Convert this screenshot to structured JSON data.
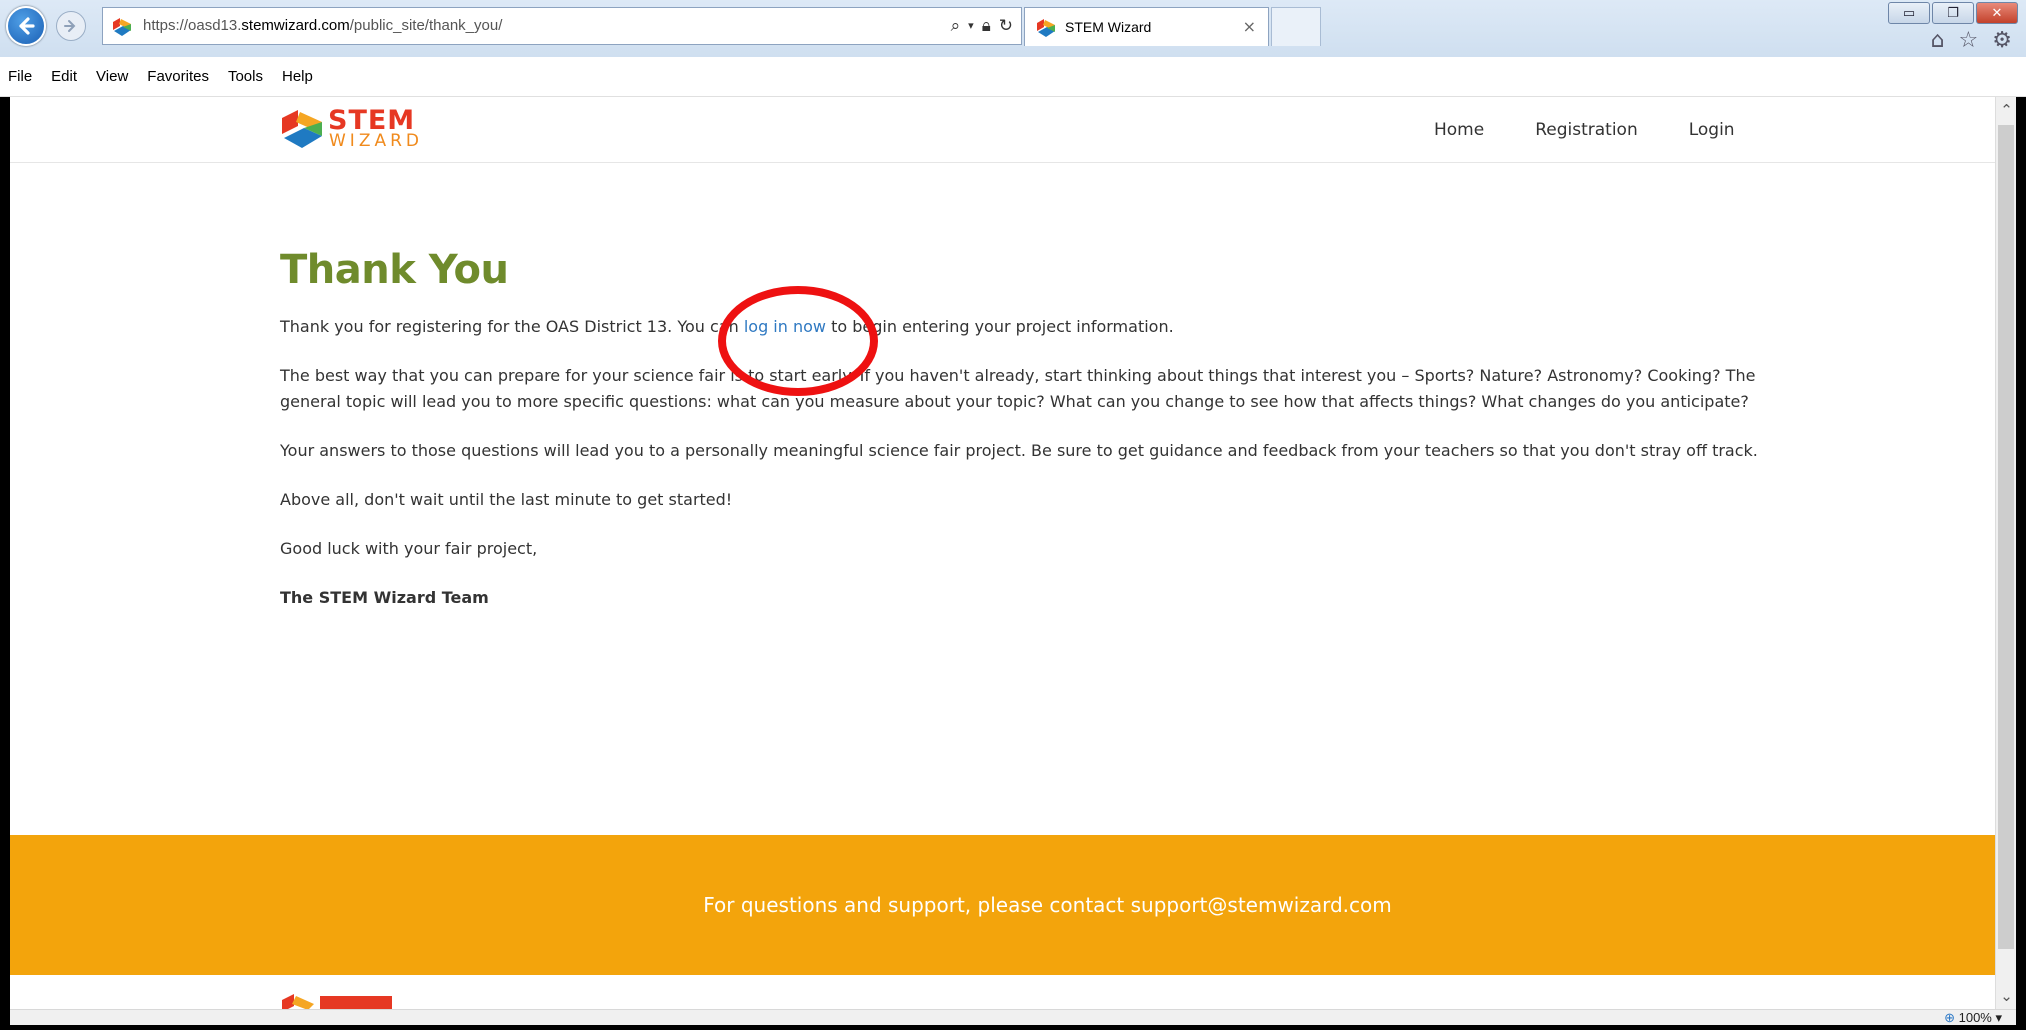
{
  "browser": {
    "address": {
      "url_prefix": "https://oasd13.",
      "url_domain": "stemwizard.com",
      "url_path": "/public_site/thank_you/"
    },
    "tab": {
      "title": "STEM Wizard",
      "close": "×"
    },
    "window_controls": {
      "minimize": "▭",
      "maximize": "❐",
      "close": "✕"
    },
    "toolbar_icons": {
      "home": "⌂",
      "favorites": "☆",
      "tools": "⚙"
    },
    "menu": [
      "File",
      "Edit",
      "View",
      "Favorites",
      "Tools",
      "Help"
    ],
    "zoom": "100%"
  },
  "site": {
    "logo": {
      "word1": "STEM",
      "word2": "WIZARD"
    },
    "nav": [
      "Home",
      "Registration",
      "Login"
    ]
  },
  "content": {
    "title": "Thank You",
    "p1_before": "Thank you for registering for the OAS District 13. You can ",
    "p1_link": "log in now",
    "p1_after": " to begin entering your project information.",
    "p2": "The best way that you can prepare for your science fair is to start early. If you haven't already, start thinking about things that interest you – Sports? Nature? Astronomy? Cooking? The general topic will lead you to more specific questions: what can you measure about your topic? What can you change to see how that affects things? What changes do you anticipate?",
    "p3": "Your answers to those questions will lead you to a personally meaningful science fair project. Be sure to get guidance and feedback from your teachers so that you don't stray off track.",
    "p4": "Above all, don't wait until the last minute to get started!",
    "p5": "Good luck with your fair project,",
    "signoff": "The STEM Wizard Team"
  },
  "footer": {
    "text": "For questions and support, please contact support@stemwizard.com"
  },
  "colors": {
    "title_green": "#6f8b2c",
    "link_blue": "#2f79c2",
    "footer_orange": "#f3a40c",
    "annotation_red": "#ee1111"
  }
}
